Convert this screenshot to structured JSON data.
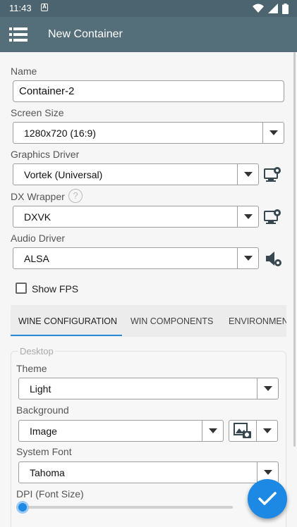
{
  "status_bar": {
    "time": "11:43",
    "notification_icon": "A"
  },
  "app_bar": {
    "title": "New Container",
    "menu_icon": "menu-list-icon"
  },
  "form": {
    "name_label": "Name",
    "name_value": "Container-2",
    "screen_size_label": "Screen Size",
    "screen_size_value": "1280x720 (16:9)",
    "graphics_driver_label": "Graphics Driver",
    "graphics_driver_value": "Vortek (Universal)",
    "dx_wrapper_label": "DX Wrapper",
    "dx_wrapper_help": "?",
    "dx_wrapper_value": "DXVK",
    "audio_driver_label": "Audio Driver",
    "audio_driver_value": "ALSA",
    "show_fps_label": "Show FPS",
    "show_fps_checked": false
  },
  "tabs": [
    {
      "label": "WINE CONFIGURATION",
      "active": true
    },
    {
      "label": "WIN COMPONENTS",
      "active": false
    },
    {
      "label": "ENVIRONMENT",
      "active": false
    }
  ],
  "desktop": {
    "section_title": "Desktop",
    "theme_label": "Theme",
    "theme_value": "Light",
    "background_label": "Background",
    "background_value": "Image",
    "system_font_label": "System Font",
    "system_font_value": "Tahoma",
    "dpi_label": "DPI (Font Size)",
    "dpi_slider_fraction": 0.0
  },
  "colors": {
    "accent": "#1e88e5",
    "app_bar": "#546e7a",
    "status_bar": "#4c6470"
  }
}
